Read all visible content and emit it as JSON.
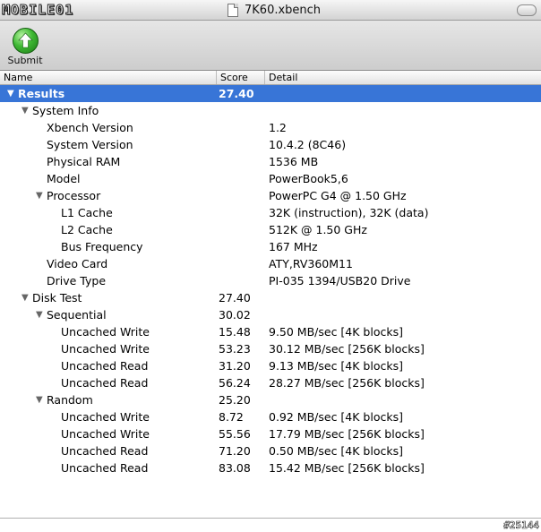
{
  "window": {
    "logo_text": "MOBILE01",
    "title": "7K60.xbench"
  },
  "toolbar": {
    "submit_label": "Submit"
  },
  "columns": {
    "name": "Name",
    "score": "Score",
    "detail": "Detail"
  },
  "rows": [
    {
      "level": 0,
      "expandable": true,
      "selected": true,
      "name": "Results",
      "score": "27.40",
      "detail": ""
    },
    {
      "level": 1,
      "expandable": true,
      "selected": false,
      "name": "System Info",
      "score": "",
      "detail": ""
    },
    {
      "level": 2,
      "expandable": false,
      "selected": false,
      "name": "Xbench Version",
      "score": "",
      "detail": "1.2"
    },
    {
      "level": 2,
      "expandable": false,
      "selected": false,
      "name": "System Version",
      "score": "",
      "detail": "10.4.2 (8C46)"
    },
    {
      "level": 2,
      "expandable": false,
      "selected": false,
      "name": "Physical RAM",
      "score": "",
      "detail": "1536 MB"
    },
    {
      "level": 2,
      "expandable": false,
      "selected": false,
      "name": "Model",
      "score": "",
      "detail": "PowerBook5,6"
    },
    {
      "level": 2,
      "expandable": true,
      "selected": false,
      "name": "Processor",
      "score": "",
      "detail": "PowerPC G4 @ 1.50 GHz"
    },
    {
      "level": 3,
      "expandable": false,
      "selected": false,
      "name": "L1 Cache",
      "score": "",
      "detail": "32K (instruction), 32K (data)"
    },
    {
      "level": 3,
      "expandable": false,
      "selected": false,
      "name": "L2 Cache",
      "score": "",
      "detail": "512K @ 1.50 GHz"
    },
    {
      "level": 3,
      "expandable": false,
      "selected": false,
      "name": "Bus Frequency",
      "score": "",
      "detail": "167 MHz"
    },
    {
      "level": 2,
      "expandable": false,
      "selected": false,
      "name": "Video Card",
      "score": "",
      "detail": "ATY,RV360M11"
    },
    {
      "level": 2,
      "expandable": false,
      "selected": false,
      "name": "Drive Type",
      "score": "",
      "detail": "PI-035 1394/USB20 Drive"
    },
    {
      "level": 1,
      "expandable": true,
      "selected": false,
      "name": "Disk Test",
      "score": "27.40",
      "detail": ""
    },
    {
      "level": 2,
      "expandable": true,
      "selected": false,
      "name": "Sequential",
      "score": "30.02",
      "detail": ""
    },
    {
      "level": 3,
      "expandable": false,
      "selected": false,
      "name": "Uncached Write",
      "score": "15.48",
      "detail": "9.50 MB/sec [4K blocks]"
    },
    {
      "level": 3,
      "expandable": false,
      "selected": false,
      "name": "Uncached Write",
      "score": "53.23",
      "detail": "30.12 MB/sec [256K blocks]"
    },
    {
      "level": 3,
      "expandable": false,
      "selected": false,
      "name": "Uncached Read",
      "score": "31.20",
      "detail": "9.13 MB/sec [4K blocks]"
    },
    {
      "level": 3,
      "expandable": false,
      "selected": false,
      "name": "Uncached Read",
      "score": "56.24",
      "detail": "28.27 MB/sec [256K blocks]"
    },
    {
      "level": 2,
      "expandable": true,
      "selected": false,
      "name": "Random",
      "score": "25.20",
      "detail": ""
    },
    {
      "level": 3,
      "expandable": false,
      "selected": false,
      "name": "Uncached Write",
      "score": "8.72",
      "detail": "0.92 MB/sec [4K blocks]"
    },
    {
      "level": 3,
      "expandable": false,
      "selected": false,
      "name": "Uncached Write",
      "score": "55.56",
      "detail": "17.79 MB/sec [256K blocks]"
    },
    {
      "level": 3,
      "expandable": false,
      "selected": false,
      "name": "Uncached Read",
      "score": "71.20",
      "detail": "0.50 MB/sec [4K blocks]"
    },
    {
      "level": 3,
      "expandable": false,
      "selected": false,
      "name": "Uncached Read",
      "score": "83.08",
      "detail": "15.42 MB/sec [256K blocks]"
    }
  ],
  "watermark": "#25144"
}
